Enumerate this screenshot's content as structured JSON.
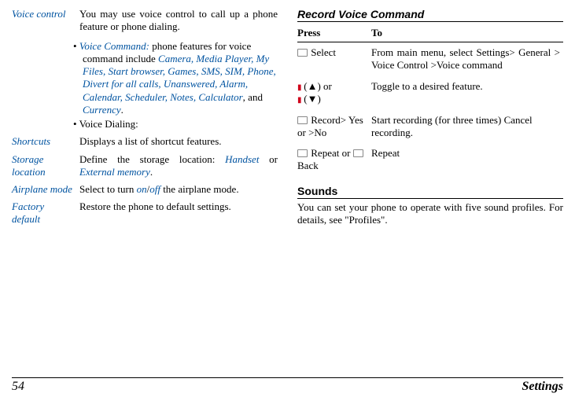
{
  "left": {
    "voice_control": {
      "label": "Voice control",
      "desc": "You may use voice control to call up a phone feature or phone dialing.",
      "b1_lead": "Voice Command:",
      "b1_mid": " phone features for voice command include ",
      "b1_list": "Camera, Media Player, My Files, Start browser, Games, SMS, SIM, Phone, Divert for all calls, Unanswered, Alarm, Calendar, Scheduler, Notes, Calculator",
      "b1_and": ", and ",
      "b1_last": "Currency",
      "b1_tail": ".",
      "b2": "Voice Dialing:"
    },
    "shortcuts": {
      "label": "Shortcuts",
      "desc": "Displays a list of shortcut features."
    },
    "storage": {
      "label": "Storage location",
      "d1": "Define the storage location: ",
      "h": "Handset",
      "or": " or ",
      "e": "External memory",
      "tail": "."
    },
    "airplane": {
      "label": "Airplane mode",
      "d1": "Select to turn ",
      "on": "on",
      "slash": "/",
      "off": "off",
      "d2": " the airplane mode."
    },
    "factory": {
      "label": "Factory default",
      "desc": "Restore the phone to default settings."
    }
  },
  "right": {
    "rvc_title": "Record Voice Command",
    "th_press": "Press",
    "th_to": "To",
    "r1_press": " Select",
    "r1_to": "From main menu, select Settings> General > Voice Control >Voice command",
    "r2_press_a": " (▲) or ",
    "r2_press_b": " (▼)",
    "r2_to": "Toggle to a desired feature.",
    "r3_press": " Record> Yes or >No",
    "r3_to": "Start recording (for three times) Cancel recording.",
    "r4_press_a": " Repeat or ",
    "r4_press_b": " Back",
    "r4_to": "Repeat",
    "sounds_title": "Sounds",
    "sounds_body": "You can set your phone to operate with five sound profiles. For details, see \"Profiles\"."
  },
  "footer": {
    "page": "54",
    "section": "Settings"
  }
}
